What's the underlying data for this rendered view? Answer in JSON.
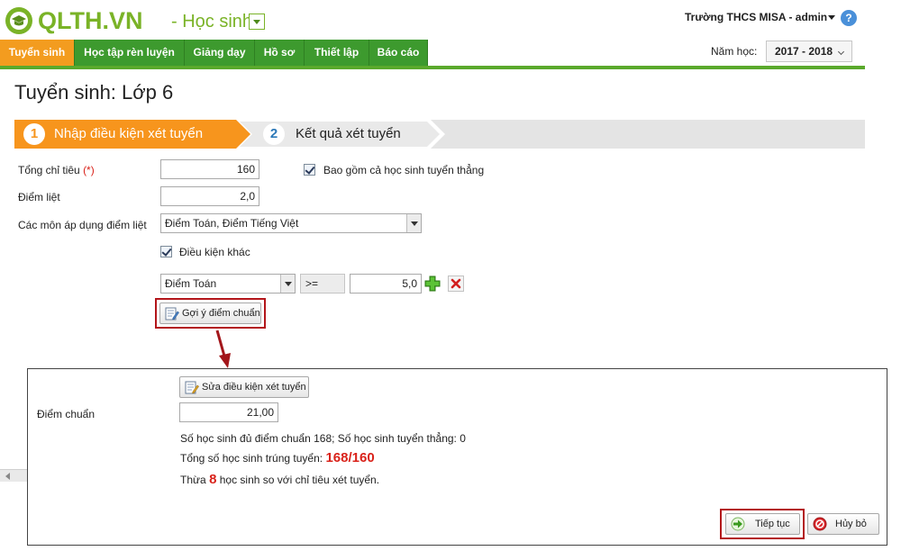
{
  "header": {
    "logo_text": "QLTH.VN",
    "module": "- Học sinh",
    "user": "Trường THCS MISA - admin",
    "help": "?"
  },
  "nav": {
    "tabs": [
      "Tuyển sinh",
      "Học tập rèn luyện",
      "Giảng dạy",
      "Hồ sơ",
      "Thiết lập",
      "Báo cáo"
    ],
    "active_index": 0,
    "year_label": "Năm học:",
    "year_value": "2017 - 2018"
  },
  "page": {
    "title": "Tuyển sinh: Lớp 6"
  },
  "steps": [
    {
      "num": "1",
      "label": "Nhập điều kiện xét tuyển"
    },
    {
      "num": "2",
      "label": "Kết quả xét tuyển"
    }
  ],
  "form": {
    "quota_label": "Tổng chỉ tiêu",
    "required_mark": "(*)",
    "quota_value": "160",
    "include_direct_label": "Bao gồm cả học sinh tuyển thẳng",
    "fail_score_label": "Điểm liệt",
    "fail_score_value": "2,0",
    "subjects_label": "Các môn áp dụng điểm liệt",
    "subjects_value": "Điểm Toán, Điểm Tiếng Việt",
    "other_conditions_label": "Điều kiện khác",
    "condition": {
      "subject": "Điểm Toán",
      "operator": ">=",
      "value": "5,0"
    },
    "suggest_button": "Gợi ý điểm chuẩn"
  },
  "dialog": {
    "edit_button": "Sửa điều kiện xét tuyển",
    "cutoff_label": "Điểm chuẩn",
    "cutoff_value": "21,00",
    "line1": "Số học sinh đủ điểm chuẩn 168; Số học sinh tuyển thẳng: 0",
    "line2_prefix": "Tổng số học sinh trúng tuyển:",
    "line2_value": "168/160",
    "line3_prefix": "Thừa",
    "line3_value": "8",
    "line3_suffix": "học sinh so với chỉ tiêu xét tuyển.",
    "continue_button": "Tiếp tục",
    "cancel_button": "Hủy bỏ"
  },
  "colors": {
    "brand_green": "#7ab327",
    "nav_green": "#3d9a2e",
    "active_orange": "#f39c1f",
    "highlight_red": "#b3161b"
  }
}
